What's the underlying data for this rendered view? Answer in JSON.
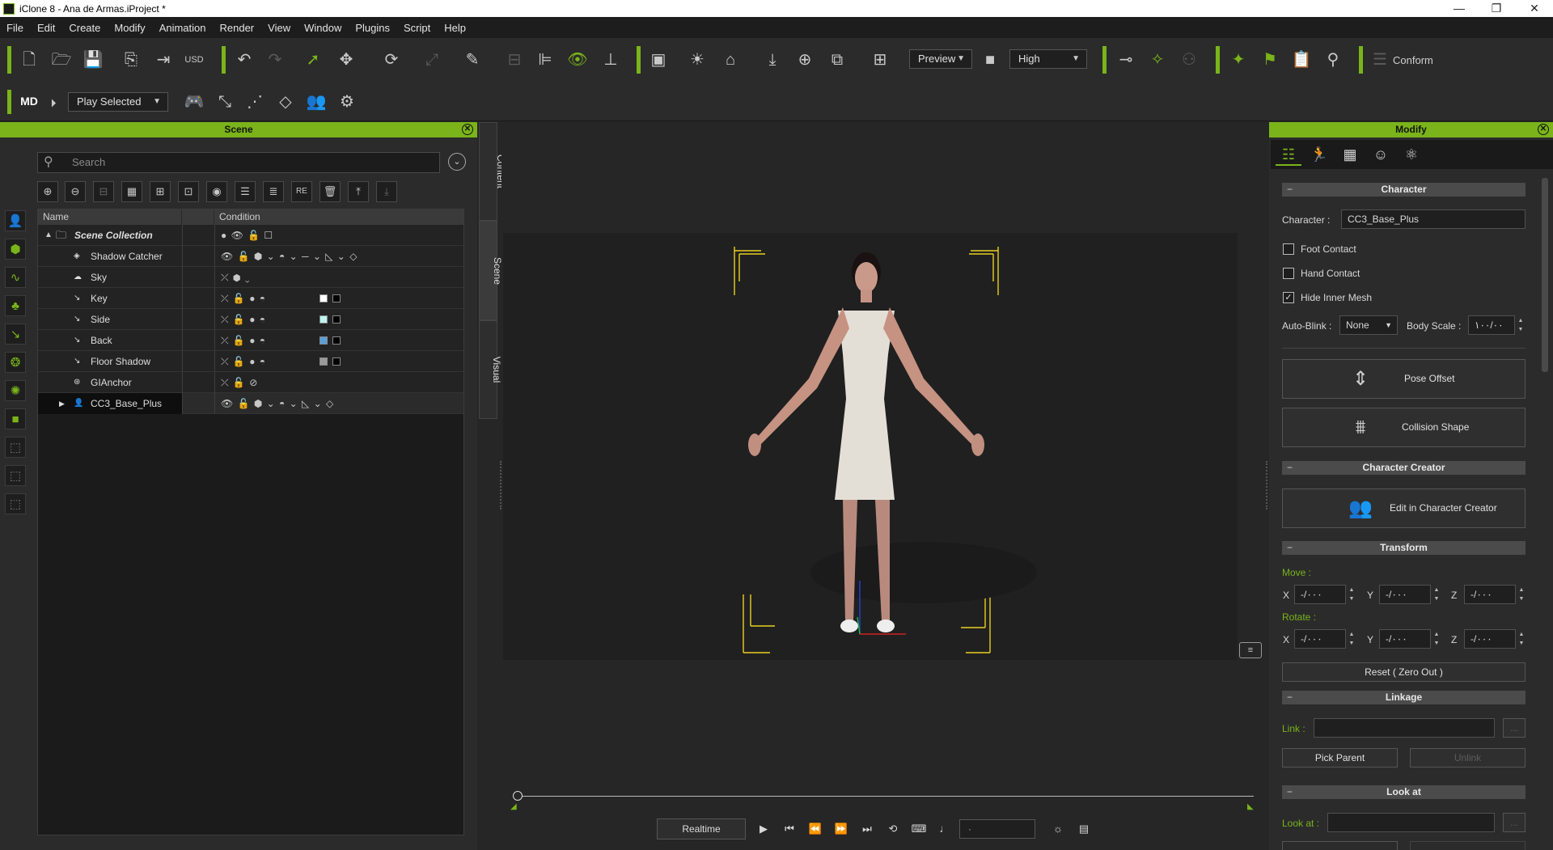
{
  "window": {
    "title": "iClone 8 - Ana de Armas.iProject *",
    "controls": [
      "—",
      "❐",
      "✕"
    ]
  },
  "menu": [
    "File",
    "Edit",
    "Create",
    "Modify",
    "Animation",
    "Render",
    "View",
    "Window",
    "Plugins",
    "Script",
    "Help"
  ],
  "toolbar": {
    "preview_dropdown": "Preview",
    "quality_dropdown": "High",
    "conform_label": "Conform",
    "play_selected_dropdown": "Play Selected"
  },
  "scene_panel": {
    "title": "Scene",
    "search_placeholder": "Search",
    "columns": {
      "name": "Name",
      "condition": "Condition"
    },
    "rows": [
      {
        "name": "Scene Collection",
        "icon": "▲",
        "cond": "●     👁     🔓     ☐"
      },
      {
        "name": "Shadow Catcher",
        "icon": "◈",
        "cond": "👁     🔓     ⬢ ⌄    ◓ ⌄    ─ ⌄    ◺ ⌄    ◇"
      },
      {
        "name": "Sky",
        "icon": "☁",
        "cond": "⤫     ⬢ ⌄"
      },
      {
        "name": "Key",
        "icon": "↘",
        "cond": "⤫     🔓     ●     ◓",
        "swatches": [
          "#ffffff",
          "#000000"
        ]
      },
      {
        "name": "Side",
        "icon": "↘",
        "cond": "⤫     🔓     ●     ◓",
        "swatches": [
          "#bff3ef",
          "#000000"
        ]
      },
      {
        "name": "Back",
        "icon": "↘",
        "cond": "⤫     🔓     ●     ◓",
        "swatches": [
          "#5a9fd8",
          "#000000"
        ]
      },
      {
        "name": "Floor Shadow",
        "icon": "↘",
        "cond": "⤫     🔓     ●     ◓",
        "swatches": [
          "#9a9a9a",
          "#000000"
        ]
      },
      {
        "name": "GIAnchor",
        "icon": "⊛",
        "cond": "⤫     🔓     ⊘"
      },
      {
        "name": "CC3_Base_Plus",
        "icon": "👤",
        "cond": "👁     🔓     ⬢ ⌄    ◓ ⌄    ◺ ⌄    ◇"
      }
    ]
  },
  "side_tabs": [
    "Content",
    "Scene",
    "Visual"
  ],
  "playback": {
    "realtime_label": "Realtime",
    "frame_value": "·"
  },
  "modify_panel": {
    "title": "Modify",
    "character_section": "Character",
    "character_label": "Character :",
    "character_value": "CC3_Base_Plus",
    "foot_contact": {
      "label": "Foot Contact",
      "checked": false
    },
    "hand_contact": {
      "label": "Hand Contact",
      "checked": false
    },
    "hide_inner_mesh": {
      "label": "Hide Inner Mesh",
      "checked": true
    },
    "auto_blink_label": "Auto-Blink :",
    "auto_blink_value": "None",
    "body_scale_label": "Body Scale :",
    "body_scale_value": "١٠٠/٠٠",
    "pose_offset": "Pose Offset",
    "collision_shape": "Collision Shape",
    "character_creator_section": "Character Creator",
    "edit_in_cc": "Edit in Character Creator",
    "transform_section": "Transform",
    "move_label": "Move :",
    "rotate_label": "Rotate :",
    "axis": {
      "x": "X",
      "y": "Y",
      "z": "Z"
    },
    "move_values": [
      "-/٠٠٠",
      "-/٠٠٠",
      "-/٠٠٠"
    ],
    "rotate_values": [
      "-/٠٠٠",
      "-/٠٠٠",
      "-/٠٠٠"
    ],
    "reset_label": "Reset ( Zero Out )",
    "linkage_section": "Linkage",
    "link_label": "Link :",
    "link_value": "",
    "link_more": "...",
    "pick_parent": "Pick Parent",
    "unlink": "Unlink",
    "look_at_section": "Look at",
    "look_at_label": "Look at :",
    "look_at_value": "",
    "look_at_more": "..."
  },
  "colors": {
    "accent": "#7ab41a",
    "panel": "#2b2b2b",
    "viewport": "#202020"
  }
}
